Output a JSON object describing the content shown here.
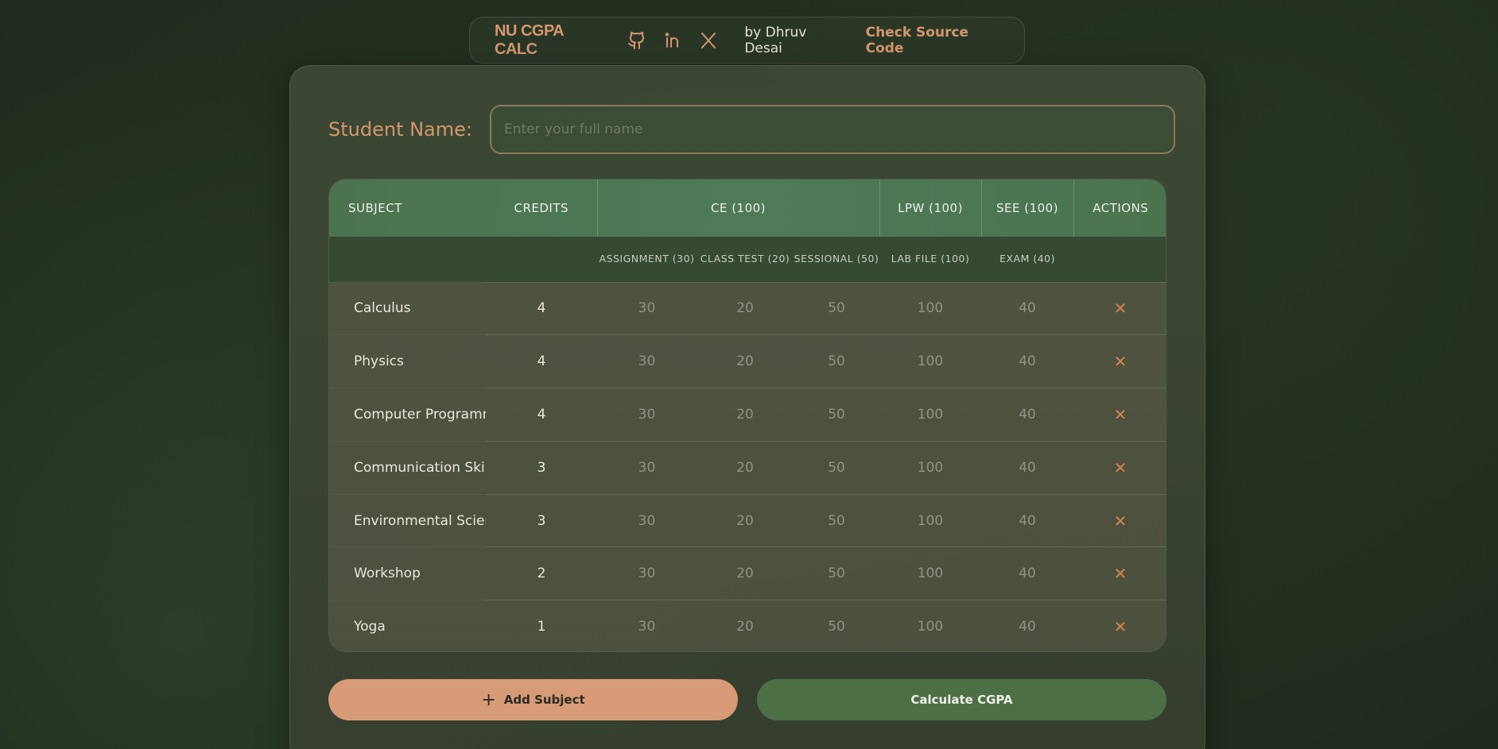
{
  "nav": {
    "brand": "NU CGPA CALC",
    "icons": [
      "github-icon",
      "linkedin-icon",
      "x-icon"
    ],
    "byline": "by Dhruv Desai",
    "source_link": "Check Source Code"
  },
  "form": {
    "name_label": "Student Name:",
    "name_placeholder": "Enter your full name",
    "name_value": ""
  },
  "table": {
    "headers": {
      "subject": "SUBJECT",
      "credits": "CREDITS",
      "ce": "CE (100)",
      "lpw": "LPW (100)",
      "see": "SEE (100)",
      "actions": "ACTIONS"
    },
    "subheaders": {
      "assignment": "ASSIGNMENT (30)",
      "class_test": "CLASS TEST (20)",
      "sessional": "SESSIONAL (50)",
      "lab_file": "LAB FILE (100)",
      "exam": "EXAM (40)"
    },
    "rows": [
      {
        "subject": "Calculus",
        "credits": "4",
        "assignment": "30",
        "class_test": "20",
        "sessional": "50",
        "lab_file": "100",
        "exam": "40",
        "action": "✕"
      },
      {
        "subject": "Physics",
        "credits": "4",
        "assignment": "30",
        "class_test": "20",
        "sessional": "50",
        "lab_file": "100",
        "exam": "40",
        "action": "✕"
      },
      {
        "subject": "Computer Programmi",
        "credits": "4",
        "assignment": "30",
        "class_test": "20",
        "sessional": "50",
        "lab_file": "100",
        "exam": "40",
        "action": "✕"
      },
      {
        "subject": "Communication Skills",
        "credits": "3",
        "assignment": "30",
        "class_test": "20",
        "sessional": "50",
        "lab_file": "100",
        "exam": "40",
        "action": "✕"
      },
      {
        "subject": "Environmental Scienc",
        "credits": "3",
        "assignment": "30",
        "class_test": "20",
        "sessional": "50",
        "lab_file": "100",
        "exam": "40",
        "action": "✕"
      },
      {
        "subject": "Workshop",
        "credits": "2",
        "assignment": "30",
        "class_test": "20",
        "sessional": "50",
        "lab_file": "100",
        "exam": "40",
        "action": "✕"
      },
      {
        "subject": "Yoga",
        "credits": "1",
        "assignment": "30",
        "class_test": "20",
        "sessional": "50",
        "lab_file": "100",
        "exam": "40",
        "action": "✕"
      }
    ]
  },
  "buttons": {
    "add_subject": "Add Subject",
    "add_icon": "plus-icon",
    "calculate": "Calculate CGPA"
  },
  "colors": {
    "accent": "#d4976e",
    "header_green": "#4b744e",
    "calc_button": "#4d6f46"
  }
}
